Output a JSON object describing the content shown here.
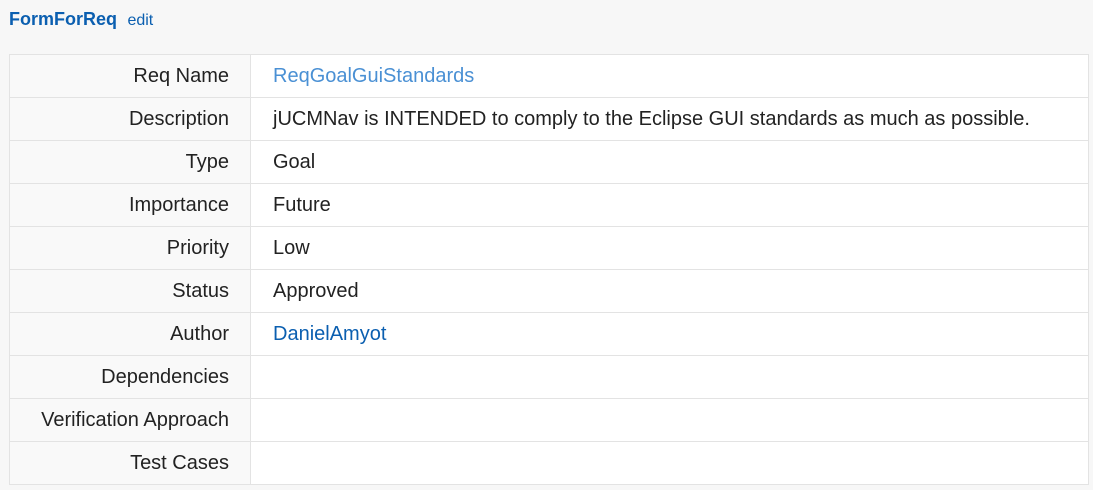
{
  "header": {
    "title": "FormForReq",
    "edit_label": "edit"
  },
  "rows": [
    {
      "label": "Req Name",
      "value": "ReqGoalGuiStandards",
      "link": true
    },
    {
      "label": "Description",
      "value": "jUCMNav is INTENDED to comply to the Eclipse GUI standards as much as possible.",
      "link": false
    },
    {
      "label": "Type",
      "value": "Goal",
      "link": false
    },
    {
      "label": "Importance",
      "value": "Future",
      "link": false
    },
    {
      "label": "Priority",
      "value": "Low",
      "link": false
    },
    {
      "label": "Status",
      "value": "Approved",
      "link": false
    },
    {
      "label": "Author",
      "value": "DanielAmyot",
      "link": true
    },
    {
      "label": "Dependencies",
      "value": "",
      "link": false
    },
    {
      "label": "Verification Approach",
      "value": "",
      "link": false
    },
    {
      "label": "Test Cases",
      "value": "",
      "link": false
    }
  ],
  "colors": {
    "link": "#0b5fb0",
    "link_light": "#4a90d4",
    "border": "#e3e3e3"
  }
}
